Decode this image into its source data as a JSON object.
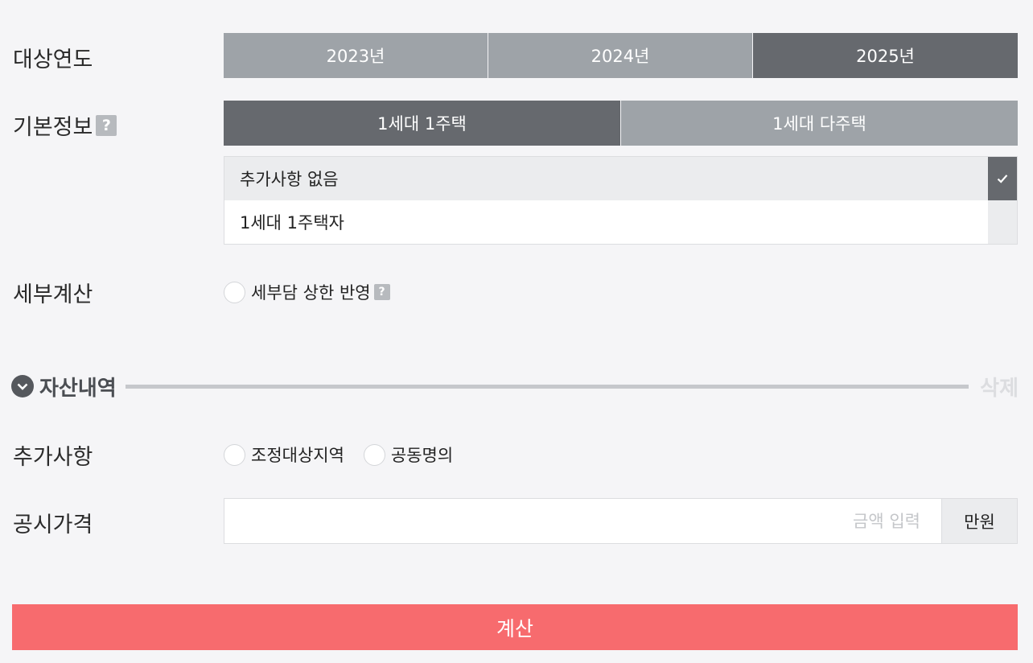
{
  "year": {
    "label": "대상연도",
    "options": [
      "2023년",
      "2024년",
      "2025년"
    ],
    "selected": "2025년"
  },
  "basic_info": {
    "label": "기본정보",
    "help": "?",
    "options": [
      "1세대 1주택",
      "1세대 다주택"
    ],
    "selected": "1세대 1주택",
    "sub_options": [
      "추가사항 없음",
      "1세대 1주택자"
    ],
    "sub_selected": "추가사항 없음"
  },
  "detail_calc": {
    "label": "세부계산",
    "option": "세부담 상한 반영",
    "help": "?"
  },
  "assets": {
    "title": "자산내역",
    "delete": "삭제",
    "icon": "chevron-down-icon",
    "extra_label": "추가사항",
    "extra_options": [
      "조정대상지역",
      "공동명의"
    ],
    "price_label": "공시가격",
    "price_value": "",
    "price_placeholder": "금액 입력",
    "price_unit": "만원"
  },
  "calculate": "계산",
  "colors": {
    "background": "#f5f5f7",
    "segment_inactive": "#9ea3a8",
    "segment_active": "#66696e",
    "accent": "#f76b6e"
  }
}
